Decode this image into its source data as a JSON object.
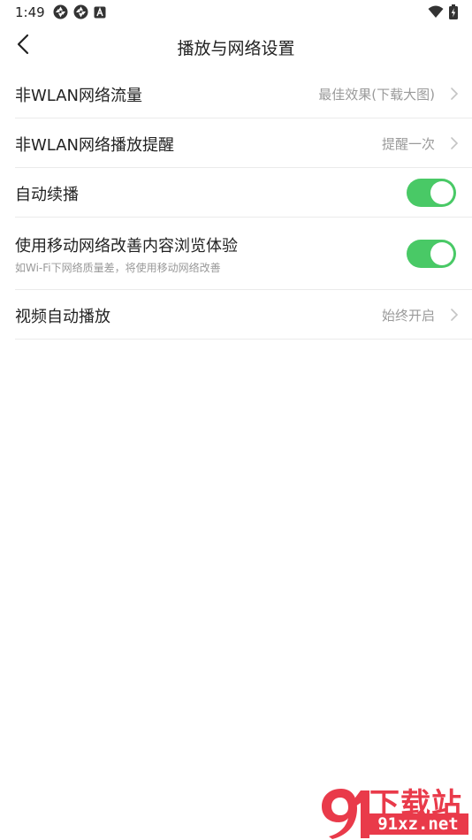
{
  "status_bar": {
    "time": "1:49",
    "left_icons": [
      "aperture-icon",
      "aperture-icon",
      "a-box-icon"
    ],
    "right_icons": [
      "wifi-icon",
      "battery-charging-icon"
    ]
  },
  "nav": {
    "back_icon": "chevron-left-icon",
    "title": "播放与网络设置"
  },
  "settings": {
    "items": [
      {
        "label": "非WLAN网络流量",
        "value": "最佳效果(下载大图)",
        "control": "chevron"
      },
      {
        "label": "非WLAN网络播放提醒",
        "value": "提醒一次",
        "control": "chevron"
      },
      {
        "label": "自动续播",
        "control": "toggle",
        "on": true
      },
      {
        "label": "使用移动网络改善内容浏览体验",
        "sublabel": "如Wi-Fi下网络质量差，将使用移动网络改善",
        "control": "toggle",
        "on": true
      },
      {
        "label": "视频自动播放",
        "value": "始终开启",
        "control": "chevron"
      }
    ]
  },
  "colors": {
    "toggle_on": "#49c966",
    "watermark_red": "#e93a4a"
  },
  "watermark": {
    "top_text": "下载站",
    "bottom_text": "91xz.net"
  }
}
